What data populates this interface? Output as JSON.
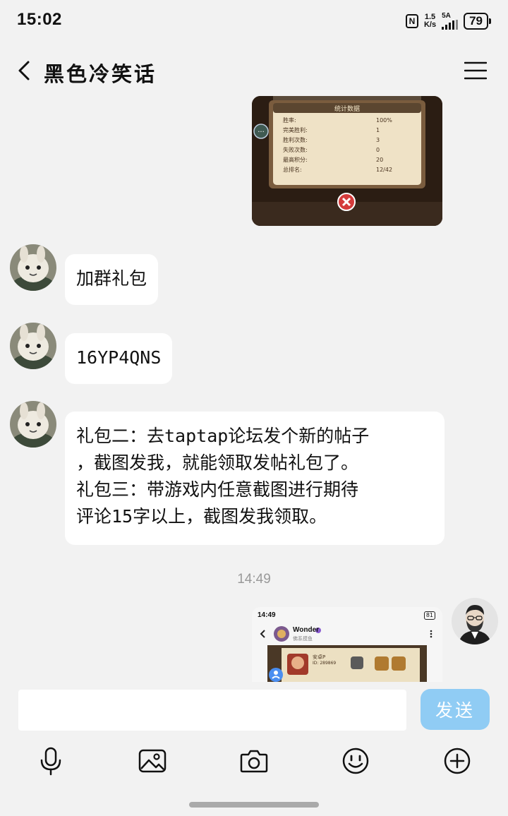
{
  "status_bar": {
    "time": "15:02",
    "net_speed_value": "1.5",
    "net_speed_unit": "K/s",
    "signal_label": "5A",
    "battery": "79"
  },
  "header": {
    "title": "黑色冷笑话",
    "back_icon": "chevron-left-icon",
    "menu_icon": "hamburger-menu-icon"
  },
  "messages": {
    "received_image_1": {
      "panel_title": "统计数据",
      "rows": [
        {
          "label": "胜率:",
          "value": "100%"
        },
        {
          "label": "完美胜利:",
          "value": "1"
        },
        {
          "label": "胜利次数:",
          "value": "3"
        },
        {
          "label": "失败次数:",
          "value": "0"
        },
        {
          "label": "最高积分:",
          "value": "20"
        },
        {
          "label": "总排名:",
          "value": "12/42"
        }
      ],
      "close_icon": "close-icon"
    },
    "text_1": "加群礼包",
    "text_2": "16YP4QNS",
    "text_3_lines": [
      "礼包二：去taptap论坛发个新的帖子",
      "，截图发我，就能领取发帖礼包了。",
      "礼包三：带游戏内任意截图进行期待",
      "评论15字以上，截图发我领取。"
    ],
    "time_divider": "14:49",
    "sent_image": {
      "time": "14:49",
      "battery": "81",
      "profile_name": "Wonder",
      "profile_sub": "佛系摸鱼",
      "card_name": "安卓P",
      "card_id": "ID: 289869"
    }
  },
  "input_bar": {
    "placeholder": "",
    "send_label": "发送",
    "tools": [
      "microphone-icon",
      "image-icon",
      "camera-icon",
      "emoji-icon",
      "plus-circle-icon"
    ]
  }
}
